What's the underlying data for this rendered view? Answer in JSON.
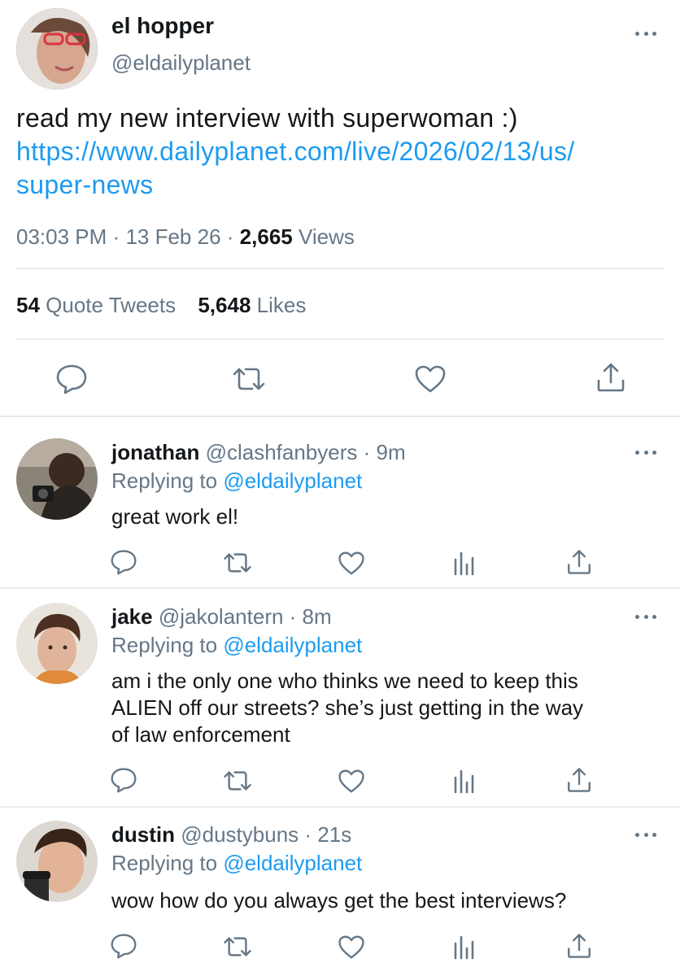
{
  "main_tweet": {
    "display_name": "el hopper",
    "handle": "@eldailyplanet",
    "text": "read my new interview with superwoman :)",
    "link_line1": "https://www.dailyplanet.com/live/2026/02/13/us/",
    "link_line2": "super-news",
    "time": "03:03 PM",
    "date": "13 Feb 26",
    "views_count": "2,665",
    "views_label": "Views",
    "quote_count": "54",
    "quote_label": "Quote Tweets",
    "likes_count": "5,648",
    "likes_label": "Likes",
    "separator": "·"
  },
  "replies": [
    {
      "name": "jonathan",
      "handle": "@clashfanbyers",
      "time": "· 9m",
      "replying_label": "Replying to",
      "replying_to": "@eldailyplanet",
      "text_lines": [
        "great work el!"
      ]
    },
    {
      "name": "jake",
      "handle": "@jakolantern",
      "time": "· 8m",
      "replying_label": "Replying to",
      "replying_to": "@eldailyplanet",
      "text_lines": [
        "am i the only one who thinks we need to keep this",
        "ALIEN off our streets? she’s just getting in the way",
        "of law enforcement"
      ]
    },
    {
      "name": "dustin",
      "handle": "@dustybuns",
      "time": "· 21s",
      "replying_label": "Replying to",
      "replying_to": "@eldailyplanet",
      "text_lines": [
        "wow how do you always get the best interviews?"
      ]
    }
  ],
  "icons": {
    "reply": "reply-icon",
    "retweet": "retweet-icon",
    "like": "heart-icon",
    "analytics": "analytics-icon",
    "share": "share-icon",
    "more": "more-icon"
  },
  "colors": {
    "link": "#1d9bf0",
    "muted": "#657786",
    "text": "#14171a",
    "divider": "#e6ecf0"
  }
}
